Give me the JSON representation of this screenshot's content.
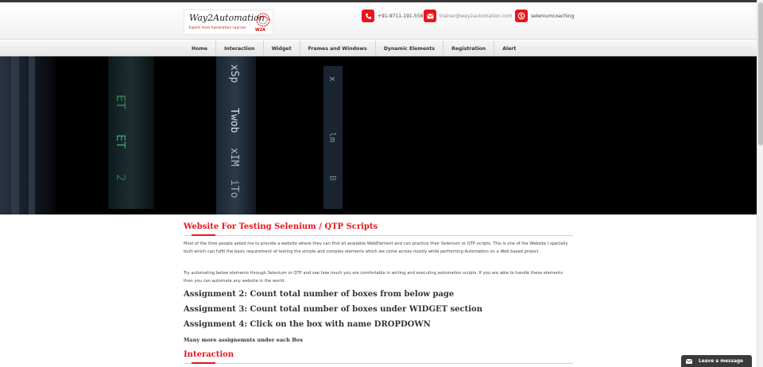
{
  "header": {
    "logo_text": "Way2Automation",
    "logo_tagline": "Expert level Automation courses",
    "logo_badge": "W2A",
    "phone": "+91-9711-191-558",
    "email": "trainer@way2automation.com",
    "skype": "seleniumcoaching",
    "icons": {
      "phone": "phone-icon",
      "email": "envelope-icon",
      "skype": "skype-icon"
    },
    "accent_color": "#e8151b"
  },
  "nav": {
    "items": [
      {
        "label": "Home"
      },
      {
        "label": "Interaction"
      },
      {
        "label": "Widget"
      },
      {
        "label": "Frames and Windows"
      },
      {
        "label": "Dynamic Elements"
      },
      {
        "label": "Registration"
      },
      {
        "label": "Alert"
      }
    ]
  },
  "main": {
    "title": "Website For Testing Selenium / QTP Scripts",
    "intro": "Most of the time people asked me to provide a website where they can find all available WebElement and can practice their Selenium or QTP scripts. This is one of the Website I specially built which can fulfil the basic requirement of testing the simple and complex elements which we come across mostly while performing Automation on a Web based project .",
    "try_text": "Try automating below elements through Selenium or QTP and see how much you are comfortable in writing and executing automation scripts. If you are able to handle these elements then you can automate any website in the world.",
    "assignments": [
      "Assignment 2: Count total number of boxes from below page",
      "Assignment 3: Count total number of boxes under WIDGET section",
      "Assignment 4: Click on the box with name DROPDOWN"
    ],
    "more_text": "Many more assignemnts under each Box",
    "section_title": "Interaction"
  },
  "chat": {
    "label": "Leave a message",
    "icon": "envelope-icon"
  }
}
